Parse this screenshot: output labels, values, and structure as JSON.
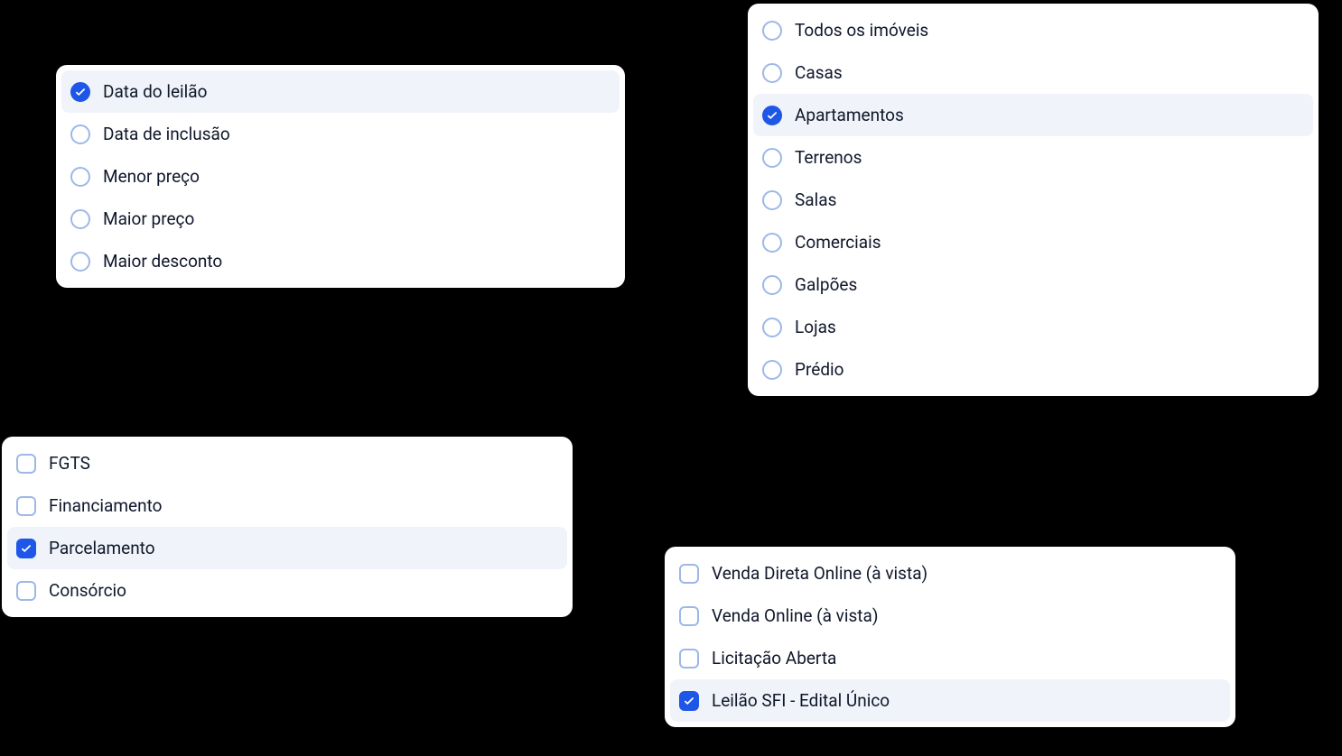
{
  "sort": {
    "options": [
      {
        "label": "Data do leilão",
        "selected": true
      },
      {
        "label": "Data de inclusão",
        "selected": false
      },
      {
        "label": "Menor preço",
        "selected": false
      },
      {
        "label": "Maior preço",
        "selected": false
      },
      {
        "label": "Maior desconto",
        "selected": false
      }
    ]
  },
  "payment": {
    "options": [
      {
        "label": "FGTS",
        "selected": false
      },
      {
        "label": "Financiamento",
        "selected": false
      },
      {
        "label": "Parcelamento",
        "selected": true
      },
      {
        "label": "Consórcio",
        "selected": false
      }
    ]
  },
  "property": {
    "options": [
      {
        "label": "Todos os imóveis",
        "selected": false
      },
      {
        "label": "Casas",
        "selected": false
      },
      {
        "label": "Apartamentos",
        "selected": true
      },
      {
        "label": "Terrenos",
        "selected": false
      },
      {
        "label": "Salas",
        "selected": false
      },
      {
        "label": "Comerciais",
        "selected": false
      },
      {
        "label": "Galpões",
        "selected": false
      },
      {
        "label": "Lojas",
        "selected": false
      },
      {
        "label": "Prédio",
        "selected": false
      }
    ]
  },
  "sale": {
    "options": [
      {
        "label": "Venda Direta Online (à vista)",
        "selected": false
      },
      {
        "label": "Venda Online (à vista)",
        "selected": false
      },
      {
        "label": "Licitação Aberta",
        "selected": false
      },
      {
        "label": "Leilão SFI - Edital Único",
        "selected": true
      }
    ]
  }
}
